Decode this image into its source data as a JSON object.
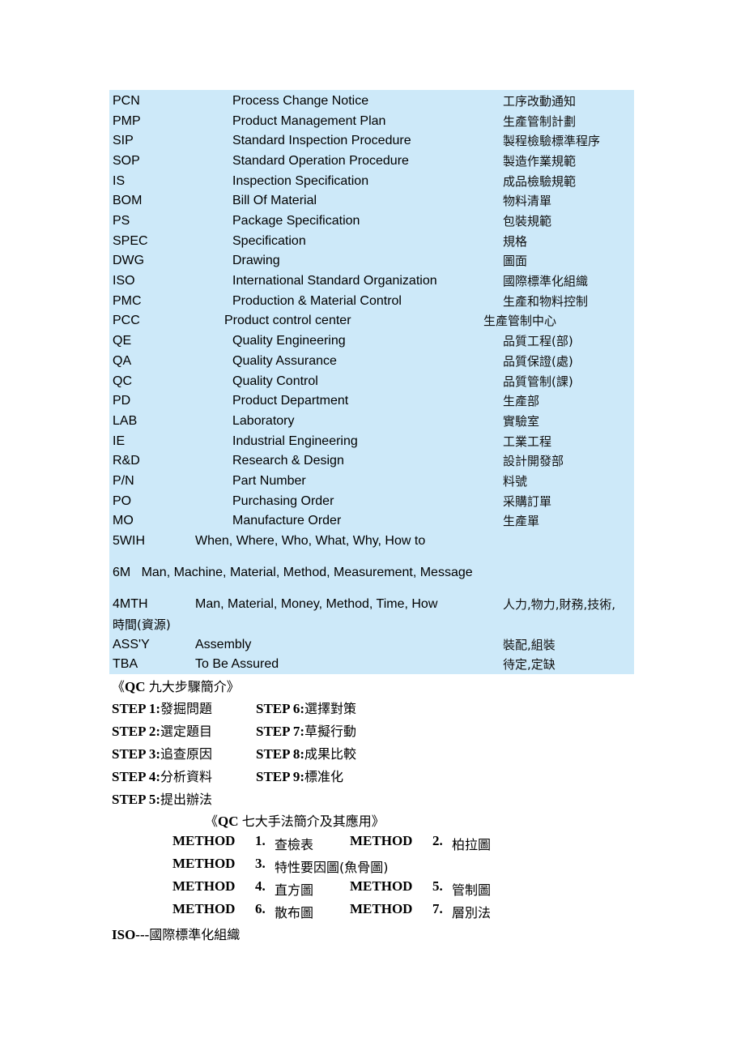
{
  "abbreviations": [
    {
      "abbr": "PCN",
      "english": "Process Change Notice",
      "chinese": "工序改動通知"
    },
    {
      "abbr": "PMP",
      "english": "Product Management Plan",
      "chinese": "生產管制計劃"
    },
    {
      "abbr": "SIP",
      "english": "Standard Inspection Procedure",
      "chinese": "製程檢驗標準程序"
    },
    {
      "abbr": "SOP",
      "english": "Standard Operation Procedure",
      "chinese": "製造作業規範"
    },
    {
      "abbr": "IS",
      "english": "Inspection Specification",
      "chinese": "成品檢驗規範"
    },
    {
      "abbr": "BOM",
      "english": "Bill Of Material",
      "chinese": "物料清單"
    },
    {
      "abbr": "PS",
      "english": "Package Specification",
      "chinese": "包裝規範"
    },
    {
      "abbr": "SPEC",
      "english": "Specification",
      "chinese": "規格"
    },
    {
      "abbr": "DWG",
      "english": "Drawing",
      "chinese": "圖面"
    },
    {
      "abbr": "ISO",
      "english": "International Standard Organization",
      "chinese": "國際標準化組織"
    },
    {
      "abbr": "PMC",
      "english": "Production & Material Control",
      "chinese": "生產和物料控制"
    },
    {
      "abbr": "PCC",
      "english": "Product control center",
      "chinese": "生產管制中心"
    },
    {
      "abbr": "QE",
      "english": "Quality Engineering",
      "chinese": "品質工程(部)"
    },
    {
      "abbr": "QA",
      "english": "Quality Assurance",
      "chinese": "品質保證(處)"
    },
    {
      "abbr": "QC",
      "english": "Quality Control",
      "chinese": "品質管制(課)"
    },
    {
      "abbr": "PD",
      "english": "Product Department",
      "chinese": "生產部"
    },
    {
      "abbr": "LAB",
      "english": "Laboratory",
      "chinese": "實驗室"
    },
    {
      "abbr": "IE",
      "english": "Industrial Engineering",
      "chinese": "工業工程"
    },
    {
      "abbr": "R&D",
      "english": "Research & Design",
      "chinese": "設計開發部"
    },
    {
      "abbr": "P/N",
      "english": "Part Number",
      "chinese": "料號"
    },
    {
      "abbr": "PO",
      "english": "Purchasing Order",
      "chinese": "采購訂單"
    },
    {
      "abbr": "MO",
      "english": "Manufacture Order",
      "chinese": "生產單"
    }
  ],
  "extra_rows": {
    "fivewih": {
      "abbr": "5WIH",
      "english": "When, Where, Who, What, Why, How to"
    },
    "sixm": {
      "text": "6M   Man, Machine, Material, Method, Measurement, Message"
    },
    "fourmth": {
      "abbr": "4MTH",
      "english": "Man, Material, Money, Method, Time, How",
      "chinese": "人力,物力,財務,技術,",
      "chinese_cont": "時間(資源)"
    },
    "assy": {
      "abbr": "ASS'Y",
      "english": "Assembly",
      "chinese": "裝配,組裝"
    },
    "tba": {
      "abbr": "TBA",
      "english": "To Be Assured",
      "chinese": "待定,定缺"
    }
  },
  "nine_steps": {
    "title_open": "《",
    "title_qc": "QC ",
    "title_rest": "九大步驟簡介》",
    "steps": [
      {
        "label": "STEP 1:",
        "text": "發掘問題"
      },
      {
        "label": "STEP 2:",
        "text": "選定題目"
      },
      {
        "label": "STEP 3:",
        "text": "追查原因"
      },
      {
        "label": "STEP 4:",
        "text": "分析資料"
      },
      {
        "label": "STEP 5:",
        "text": "提出辦法"
      },
      {
        "label": "STEP 6:",
        "text": "選擇對策"
      },
      {
        "label": "STEP 7:",
        "text": "草擬行動"
      },
      {
        "label": "STEP 8:",
        "text": "成果比較"
      },
      {
        "label": "STEP 9:",
        "text": "標准化"
      }
    ]
  },
  "seven_methods": {
    "title_open": "《",
    "title_qc": "QC ",
    "title_rest": "七大手法簡介及其應用》",
    "method_label": "METHOD",
    "methods": [
      {
        "num": "1.",
        "text": "查檢表"
      },
      {
        "num": "2.",
        "text": "柏拉圖"
      },
      {
        "num": "3.",
        "text": "特性要因圖(魚骨圖)"
      },
      {
        "num": "4.",
        "text": "直方圖"
      },
      {
        "num": "5.",
        "text": "管制圖"
      },
      {
        "num": "6.",
        "text": "散布圖"
      },
      {
        "num": "7.",
        "text": "層別法"
      }
    ]
  },
  "iso_line": {
    "label": "ISO---",
    "text": "國際標準化組織"
  }
}
